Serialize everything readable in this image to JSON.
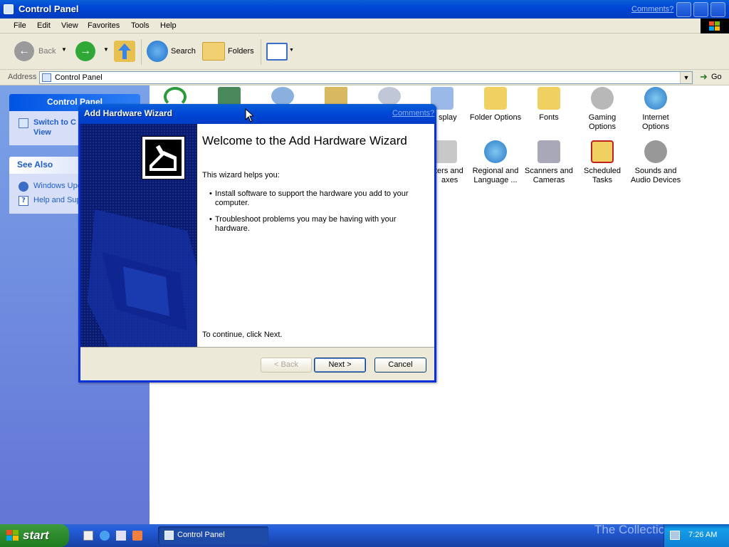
{
  "window": {
    "title": "Control Panel",
    "comments_link": "Comments?"
  },
  "menu": [
    "File",
    "Edit",
    "View",
    "Favorites",
    "Tools",
    "Help"
  ],
  "toolbar": {
    "back": "Back",
    "search": "Search",
    "folders": "Folders"
  },
  "address": {
    "label": "Address",
    "value": "Control Panel",
    "go": "Go"
  },
  "leftpane": {
    "control_panel": {
      "title": "Control Panel",
      "switch_link_l1": "Switch to C",
      "switch_link_l2": "View"
    },
    "see_also": {
      "title": "See Also",
      "windows_update": "Windows Upd",
      "help_support": "Help and Sup"
    }
  },
  "icons": [
    {
      "l1": "splay",
      "l2": ""
    },
    {
      "l1": "Folder Options",
      "l2": ""
    },
    {
      "l1": "Fonts",
      "l2": ""
    },
    {
      "l1": "Gaming",
      "l2": "Options"
    },
    {
      "l1": "Internet",
      "l2": "Options"
    },
    {
      "l1": "ters and",
      "l2": "axes"
    },
    {
      "l1": "Regional and",
      "l2": "Language ..."
    },
    {
      "l1": "Scanners and",
      "l2": "Cameras"
    },
    {
      "l1": "Scheduled",
      "l2": "Tasks"
    },
    {
      "l1": "Sounds and",
      "l2": "Audio Devices"
    }
  ],
  "wizard": {
    "title": "Add Hardware Wizard",
    "comments": "Comments?",
    "heading": "Welcome to the Add Hardware Wizard",
    "intro": "This wizard helps you:",
    "bullets": [
      {
        "l1": "Install software to support the hardware you add to your",
        "l2": "computer."
      },
      {
        "l1": "Troubleshoot problems you may be having with your",
        "l2": "hardware."
      }
    ],
    "continue": "To continue, click Next.",
    "back_btn": "< Back",
    "next_btn": "Next >",
    "cancel_btn": "Cancel"
  },
  "taskbar": {
    "start": "start",
    "task": "Control Panel",
    "clock": "7:26 AM"
  },
  "watermark": "The Collection Book",
  "colors": {
    "xp_blue": "#0054e3",
    "start_green": "#3c9a3c",
    "task_blue": "#245edb"
  }
}
